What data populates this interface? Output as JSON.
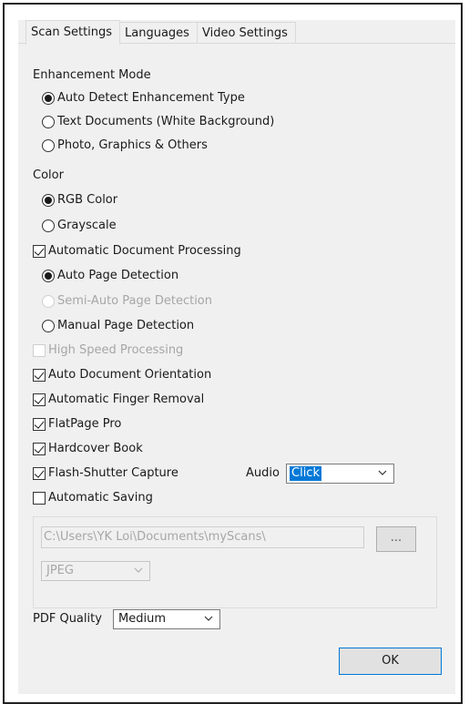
{
  "tabs": [
    {
      "label": "Scan Settings",
      "active": true
    },
    {
      "label": "Languages",
      "active": false
    },
    {
      "label": "Video Settings",
      "active": false
    }
  ],
  "enhancement": {
    "heading": "Enhancement Mode",
    "options": [
      {
        "label": "Auto Detect Enhancement Type",
        "selected": true
      },
      {
        "label": "Text Documents (White Background)",
        "selected": false
      },
      {
        "label": "Photo, Graphics & Others",
        "selected": false
      }
    ]
  },
  "color": {
    "heading": "Color",
    "options": [
      {
        "label": "RGB Color",
        "selected": true
      },
      {
        "label": "Grayscale",
        "selected": false
      }
    ]
  },
  "adp": {
    "label": "Automatic Document Processing",
    "checked": true,
    "options": [
      {
        "label": "Auto Page Detection",
        "selected": true,
        "enabled": true
      },
      {
        "label": "Semi-Auto Page Detection",
        "selected": false,
        "enabled": false
      },
      {
        "label": "Manual Page Detection",
        "selected": false,
        "enabled": true
      }
    ]
  },
  "checks": {
    "high_speed": {
      "label": "High Speed Processing",
      "checked": false,
      "enabled": false
    },
    "orientation": {
      "label": "Auto Document Orientation",
      "checked": true
    },
    "finger": {
      "label": "Automatic Finger Removal",
      "checked": true
    },
    "flatpage": {
      "label": "FlatPage Pro",
      "checked": true
    },
    "hardcover": {
      "label": "Hardcover Book",
      "checked": true
    },
    "flash": {
      "label": "Flash-Shutter Capture",
      "checked": true
    },
    "autosave": {
      "label": "Automatic Saving",
      "checked": false
    }
  },
  "audio": {
    "label": "Audio",
    "value": "Click"
  },
  "saving": {
    "path": "C:\\Users\\YK Loi\\Documents\\myScans\\",
    "browse_label": "...",
    "format": "JPEG"
  },
  "pdf": {
    "label": "PDF Quality",
    "value": "Medium"
  },
  "ok_label": "OK"
}
